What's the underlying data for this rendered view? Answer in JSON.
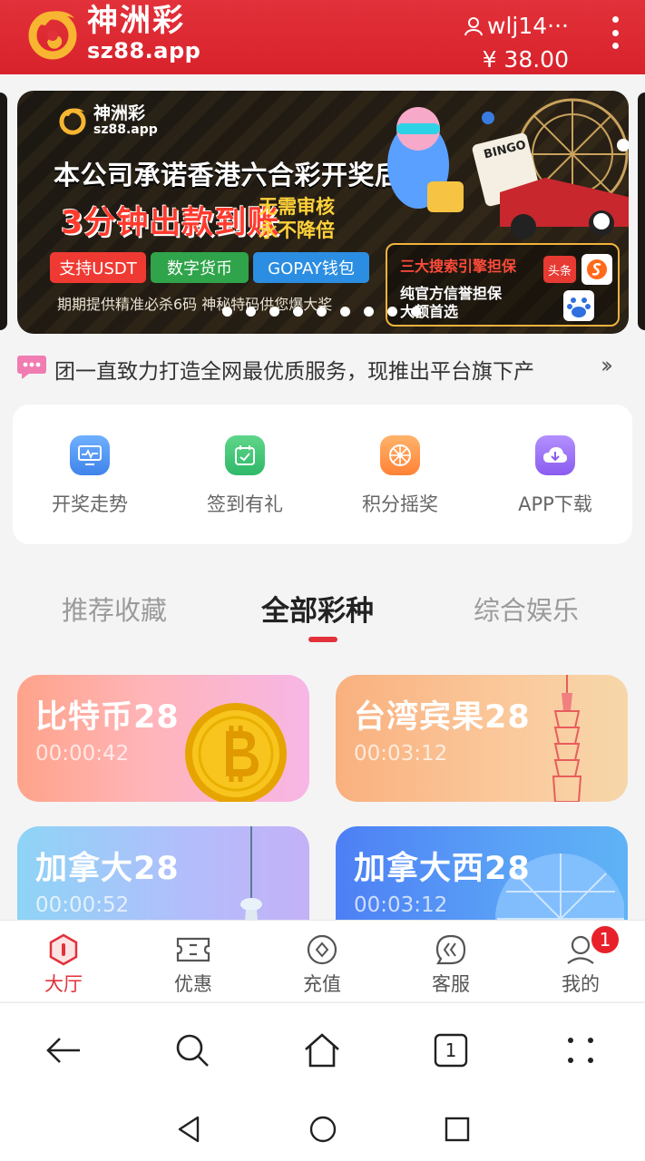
{
  "header": {
    "logo_cn": "神洲彩",
    "logo_en": "sz88.app",
    "username": "wlj14···",
    "balance": "¥ 38.00",
    "brand_color": "#e2313a"
  },
  "banner": {
    "logo_cn": "神洲彩",
    "logo_en": "sz88.app",
    "headline": "本公司承诺香港六合彩开奖后",
    "big": "3分钟出款到账",
    "side1": "无需审核",
    "side2": "永不降倍",
    "tags": [
      "支持USDT",
      "数字货币",
      "GOPAY钱包"
    ],
    "sub": "期期提供精准必杀6码 神秘特码供您爆大奖",
    "box_title": "三大搜索引擎担保",
    "box_line1": "纯官方信誉担保",
    "box_line2": "大额首选",
    "chip_toutiao": "头条",
    "art_bingo": "BINGO",
    "dot_count": 9
  },
  "notice": {
    "text": "团一直致力打造全网最优质服务，现推出平台旗下产",
    "more_icon": "double-chevron-right-icon"
  },
  "quick_actions": [
    {
      "label": "开奖走势",
      "icon": "trend-monitor-icon",
      "color": "#4a90f0"
    },
    {
      "label": "签到有礼",
      "icon": "calendar-check-icon",
      "color": "#34c06a"
    },
    {
      "label": "积分摇奖",
      "icon": "wheel-icon",
      "color": "#ff8a3a"
    },
    {
      "label": "APP下载",
      "icon": "cloud-download-icon",
      "color": "#9a6cf0"
    }
  ],
  "tabs": [
    {
      "label": "推荐收藏",
      "active": false
    },
    {
      "label": "全部彩种",
      "active": true
    },
    {
      "label": "综合娱乐",
      "active": false
    }
  ],
  "games": [
    {
      "title": "比特币28",
      "time": "00:00:42"
    },
    {
      "title": "台湾宾果28",
      "time": "00:03:12"
    },
    {
      "title": "加拿大28",
      "time": "00:00:52"
    },
    {
      "title": "加拿大西28",
      "time": "00:03:12"
    }
  ],
  "tabbar": [
    {
      "label": "大厅",
      "icon": "lobby-icon",
      "active": true
    },
    {
      "label": "优惠",
      "icon": "ticket-icon",
      "active": false
    },
    {
      "label": "充值",
      "icon": "coin-icon",
      "active": false
    },
    {
      "label": "客服",
      "icon": "service-icon",
      "active": false
    },
    {
      "label": "我的",
      "icon": "profile-icon",
      "active": false,
      "badge": "1"
    }
  ],
  "browser": {
    "tab_count": "1"
  }
}
